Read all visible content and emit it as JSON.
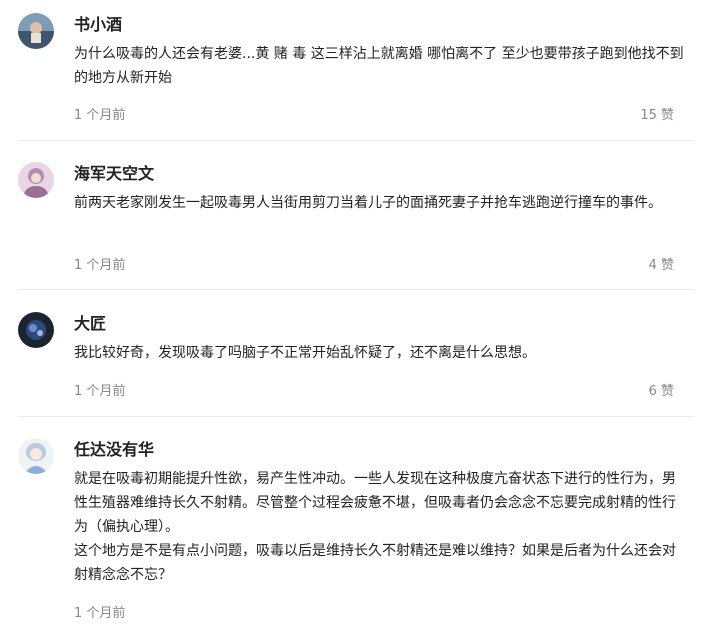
{
  "comments": [
    {
      "username": "书小酒",
      "text": [
        "为什么吸毒的人还会有老婆...黄 赌 毒 这三样沾上就离婚 哪怕离不了 至少也要带孩子跑到他找不到的地方从新开始"
      ],
      "time": "1 个月前",
      "likes": "15 赞",
      "avatar_icon": "avatar-landscape-icon"
    },
    {
      "username": "海军天空文",
      "text": [
        "前两天老家刚发生一起吸毒男人当街用剪刀当着儿子的面捅死妻子并抢车逃跑逆行撞车的事件。"
      ],
      "time": "1 个月前",
      "likes": "4 赞",
      "avatar_icon": "avatar-portrait-icon"
    },
    {
      "username": "大匠",
      "text": [
        "我比较好奇，发现吸毒了吗脑子不正常开始乱怀疑了，还不离是什么思想。"
      ],
      "time": "1 个月前",
      "likes": "6 赞",
      "avatar_icon": "avatar-dark-icon"
    },
    {
      "username": "任达没有华",
      "text": [
        "就是在吸毒初期能提升性欲，易产生性冲动。一些人发现在这种极度亢奋状态下进行的性行为，男性生殖器难维持长久不射精。尽管整个过程会疲惫不堪，但吸毒者仍会念念不忘要完成射精的性行为（偏执心理）。",
        "这个地方是不是有点小问题，吸毒以后是维持长久不射精还是难以维持？如果是后者为什么还会对射精念念不忘？"
      ],
      "time": "1 个月前",
      "likes": "",
      "avatar_icon": "avatar-anime-icon"
    }
  ]
}
